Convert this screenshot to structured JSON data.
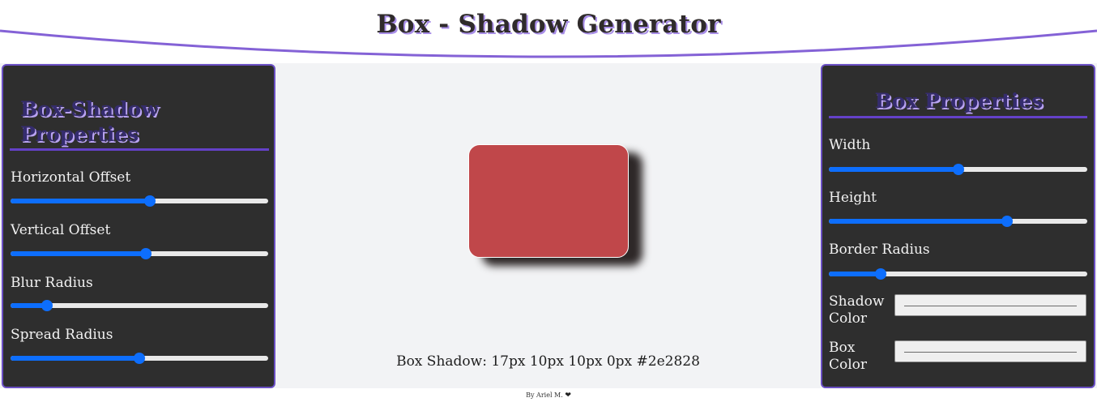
{
  "header": {
    "title": "Box - Shadow Generator"
  },
  "left_panel": {
    "title": "Box-Shadow Properties",
    "controls": [
      {
        "label": "Horizontal Offset",
        "value_fraction": 0.54
      },
      {
        "label": "Vertical Offset",
        "value_fraction": 0.525
      },
      {
        "label": "Blur Radius",
        "value_fraction": 0.14
      },
      {
        "label": "Spread Radius",
        "value_fraction": 0.5
      }
    ]
  },
  "right_panel": {
    "title": "Box Properties",
    "controls": [
      {
        "label": "Width",
        "value_fraction": 0.5
      },
      {
        "label": "Height",
        "value_fraction": 0.69
      },
      {
        "label": "Border Radius",
        "value_fraction": 0.2
      }
    ],
    "color_inputs": [
      {
        "label": "Shadow Color",
        "value": "#2e2828"
      },
      {
        "label": "Box Color",
        "value": "#c0474a"
      }
    ]
  },
  "preview": {
    "box_color": "#c0474a",
    "shadow_color": "#2e2828"
  },
  "output": {
    "text": "Box Shadow: 17px 10px 10px 0px #2e2828"
  },
  "footer": {
    "credit": "By Ariel M.",
    "heart": "❤"
  },
  "colors": {
    "accent": "#6a4fc4",
    "slider_blue": "#0d6efd",
    "panel_bg": "#2e2e2e",
    "workspace_bg": "#f2f3f5"
  }
}
